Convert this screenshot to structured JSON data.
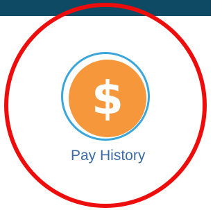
{
  "header": {
    "bar_color": "#0e4a63"
  },
  "tile": {
    "label": "Pay History",
    "icon": "dollar-icon",
    "icon_glyph": "$",
    "icon_color": "#f5973a",
    "ring_color": "#3aa6d9",
    "label_color": "#3a6aa8"
  },
  "annotation": {
    "shape": "circle",
    "color": "#ee0d0d"
  }
}
